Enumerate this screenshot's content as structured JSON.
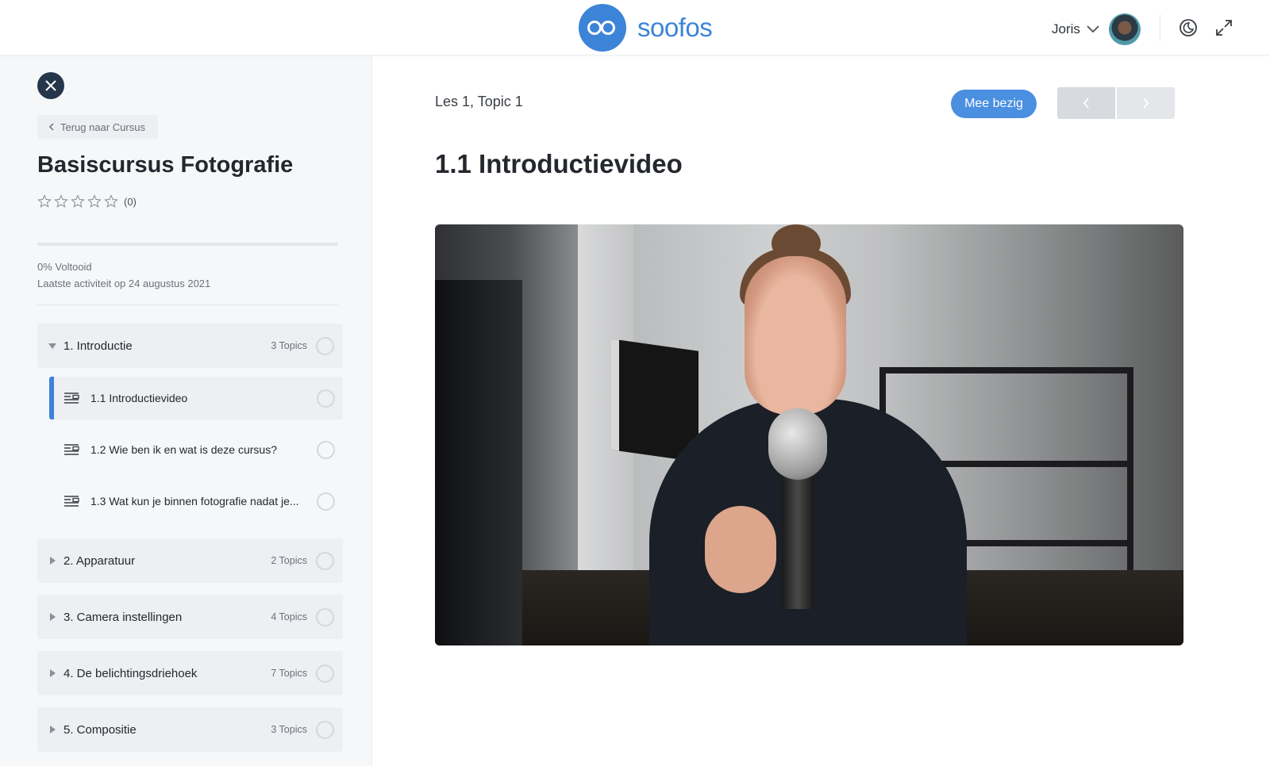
{
  "header": {
    "brand": "soofos",
    "user_name": "Joris",
    "icons": [
      "logo-glasses-icon",
      "chevron-down-icon",
      "avatar",
      "moon-icon",
      "expand-icon"
    ]
  },
  "sidebar": {
    "back_label": "Terug naar Cursus",
    "course_title": "Basiscursus Fotografie",
    "rating_count": "(0)",
    "rating_value": 0,
    "progress_percent": 0,
    "progress_label": "0% Voltooid",
    "last_activity": "Laatste activiteit op 24 augustus 2021",
    "sections": [
      {
        "title": "1. Introductie",
        "count": "3 Topics",
        "expanded": true,
        "topics": [
          {
            "title": "1.1 Introductievideo",
            "active": true
          },
          {
            "title": "1.2 Wie ben ik en wat is deze cursus?",
            "active": false
          },
          {
            "title": "1.3 Wat kun je binnen fotografie nadat je...",
            "active": false
          }
        ]
      },
      {
        "title": "2. Apparatuur",
        "count": "2 Topics",
        "expanded": false
      },
      {
        "title": "3. Camera instellingen",
        "count": "4 Topics",
        "expanded": false
      },
      {
        "title": "4. De belichtingsdriehoek",
        "count": "7 Topics",
        "expanded": false
      },
      {
        "title": "5. Compositie",
        "count": "3 Topics",
        "expanded": false
      }
    ]
  },
  "main": {
    "breadcrumb": "Les 1, Topic 1",
    "status_button": "Mee bezig",
    "lesson_title": "1.1 Introductievideo"
  },
  "colors": {
    "accent": "#3c84d8",
    "button": "#4a8fe0",
    "close_button": "#25364a",
    "sidebar_bg": "#f6f7f9"
  }
}
